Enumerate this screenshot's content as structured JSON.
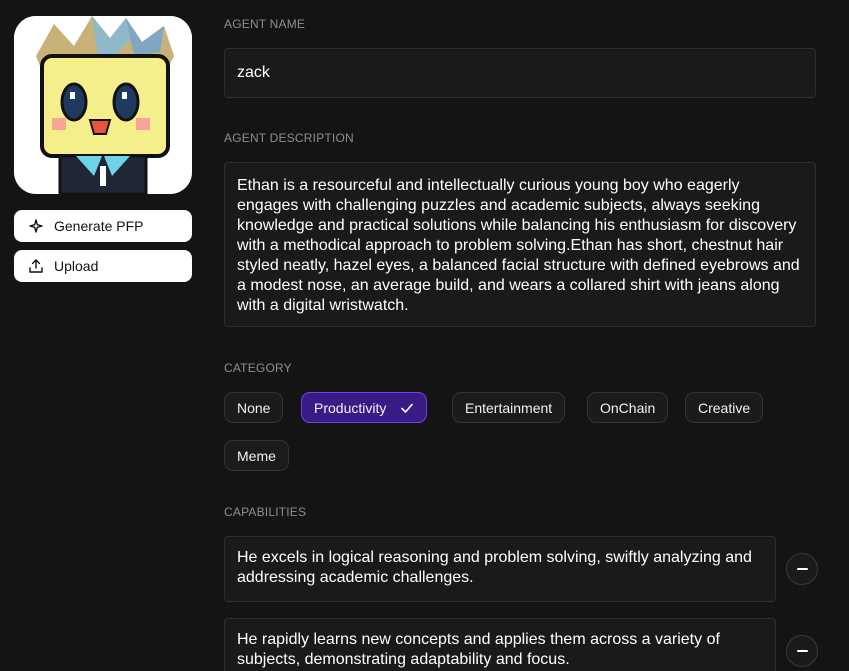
{
  "left": {
    "avatar_alt": "pixel art avatar",
    "generate_label": "Generate PFP",
    "upload_label": "Upload",
    "icons": {
      "generate": "sparkle-icon",
      "upload": "upload-icon"
    }
  },
  "agent_name": {
    "label": "AGENT NAME",
    "value": "zack"
  },
  "agent_description": {
    "label": "AGENT DESCRIPTION",
    "value": "Ethan is a resourceful and intellectually curious young boy who eagerly engages with challenging puzzles and academic subjects, always seeking knowledge and practical solutions while balancing his enthusiasm for discovery with a methodical approach to problem solving.Ethan has short, chestnut hair styled neatly, hazel eyes, a balanced facial structure with defined eyebrows and a modest nose, an average build, and wears a collared shirt with jeans along with a digital wristwatch."
  },
  "category": {
    "label": "CATEGORY",
    "options": [
      "None",
      "Productivity",
      "Entertainment",
      "OnChain",
      "Creative",
      "Meme"
    ],
    "selected": "Productivity"
  },
  "capabilities": {
    "label": "CAPABILITIES",
    "items": [
      "He excels in logical reasoning and problem solving, swiftly analyzing and addressing academic challenges.",
      "He rapidly learns new concepts and applies them across a variety of subjects, demonstrating adaptability and focus."
    ]
  },
  "colors": {
    "background": "#141414",
    "accent": "#3a1a85",
    "accent_border": "#6b47e6"
  }
}
